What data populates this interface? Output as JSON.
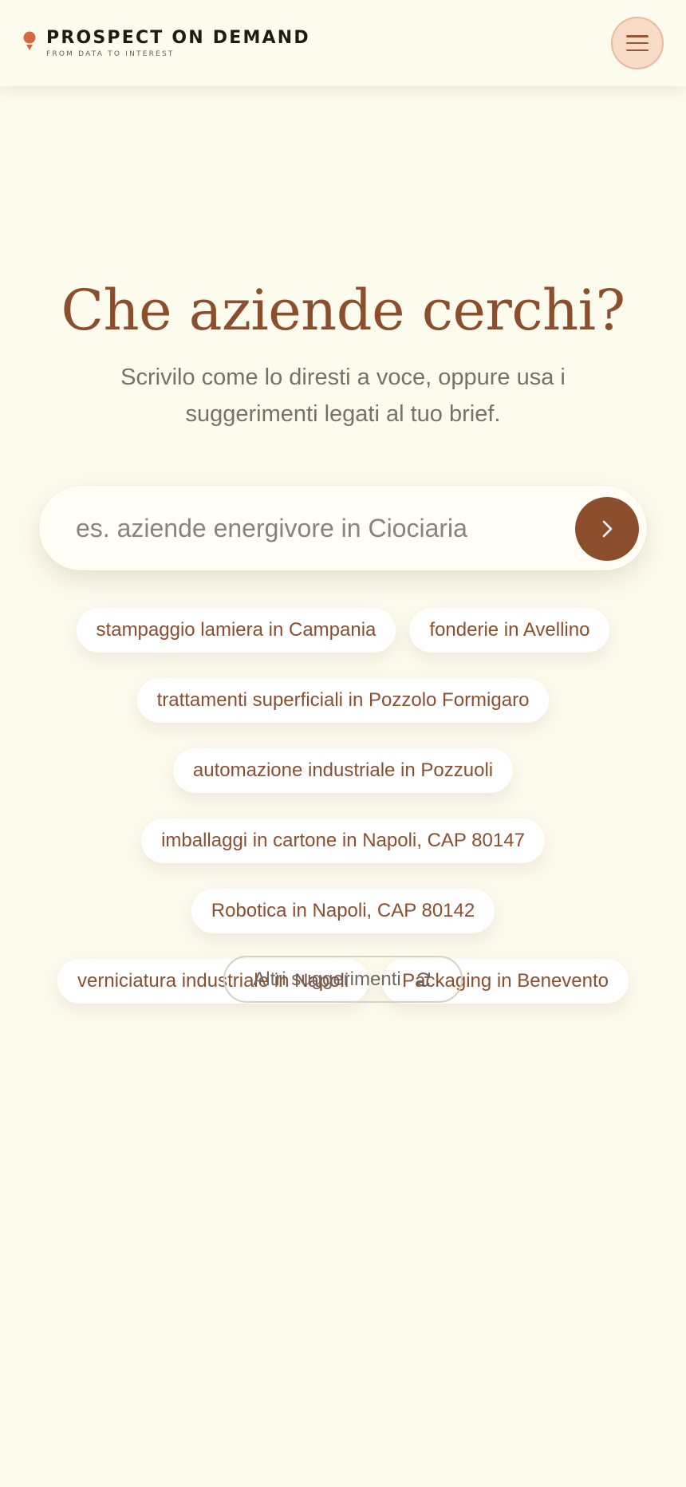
{
  "header": {
    "brand_name": "PROSPECT ON DEMAND",
    "tagline": "FROM DATA TO INTEREST",
    "logo_icon": "location-pin-icon",
    "menu_icon": "hamburger-menu-icon"
  },
  "hero": {
    "title": "Che aziende cerchi?",
    "subtitle": "Scrivilo come lo diresti a voce, oppure usa i suggerimenti legati al tuo brief."
  },
  "search": {
    "placeholder": "es. aziende energivore in Ciociaria",
    "value": "",
    "submit_icon": "chevron-right-icon"
  },
  "suggestions": [
    "stampaggio lamiera in Campania",
    "fonderie in Avellino",
    "trattamenti superficiali in Pozzolo Formigaro",
    "automazione industriale in Pozzuoli",
    "imballaggi in cartone in Napoli, CAP 80147",
    "Robotica in Napoli, CAP 80142",
    "verniciatura industriale in Napoli",
    "Packaging in Benevento"
  ],
  "more_suggestions": {
    "label": "Altri suggerimenti",
    "icon": "refresh-icon"
  },
  "colors": {
    "background": "#fdfbee",
    "accent": "#8c4f2e",
    "logo_accent": "#d2693f",
    "menu_button_bg": "#f8dcc7"
  }
}
